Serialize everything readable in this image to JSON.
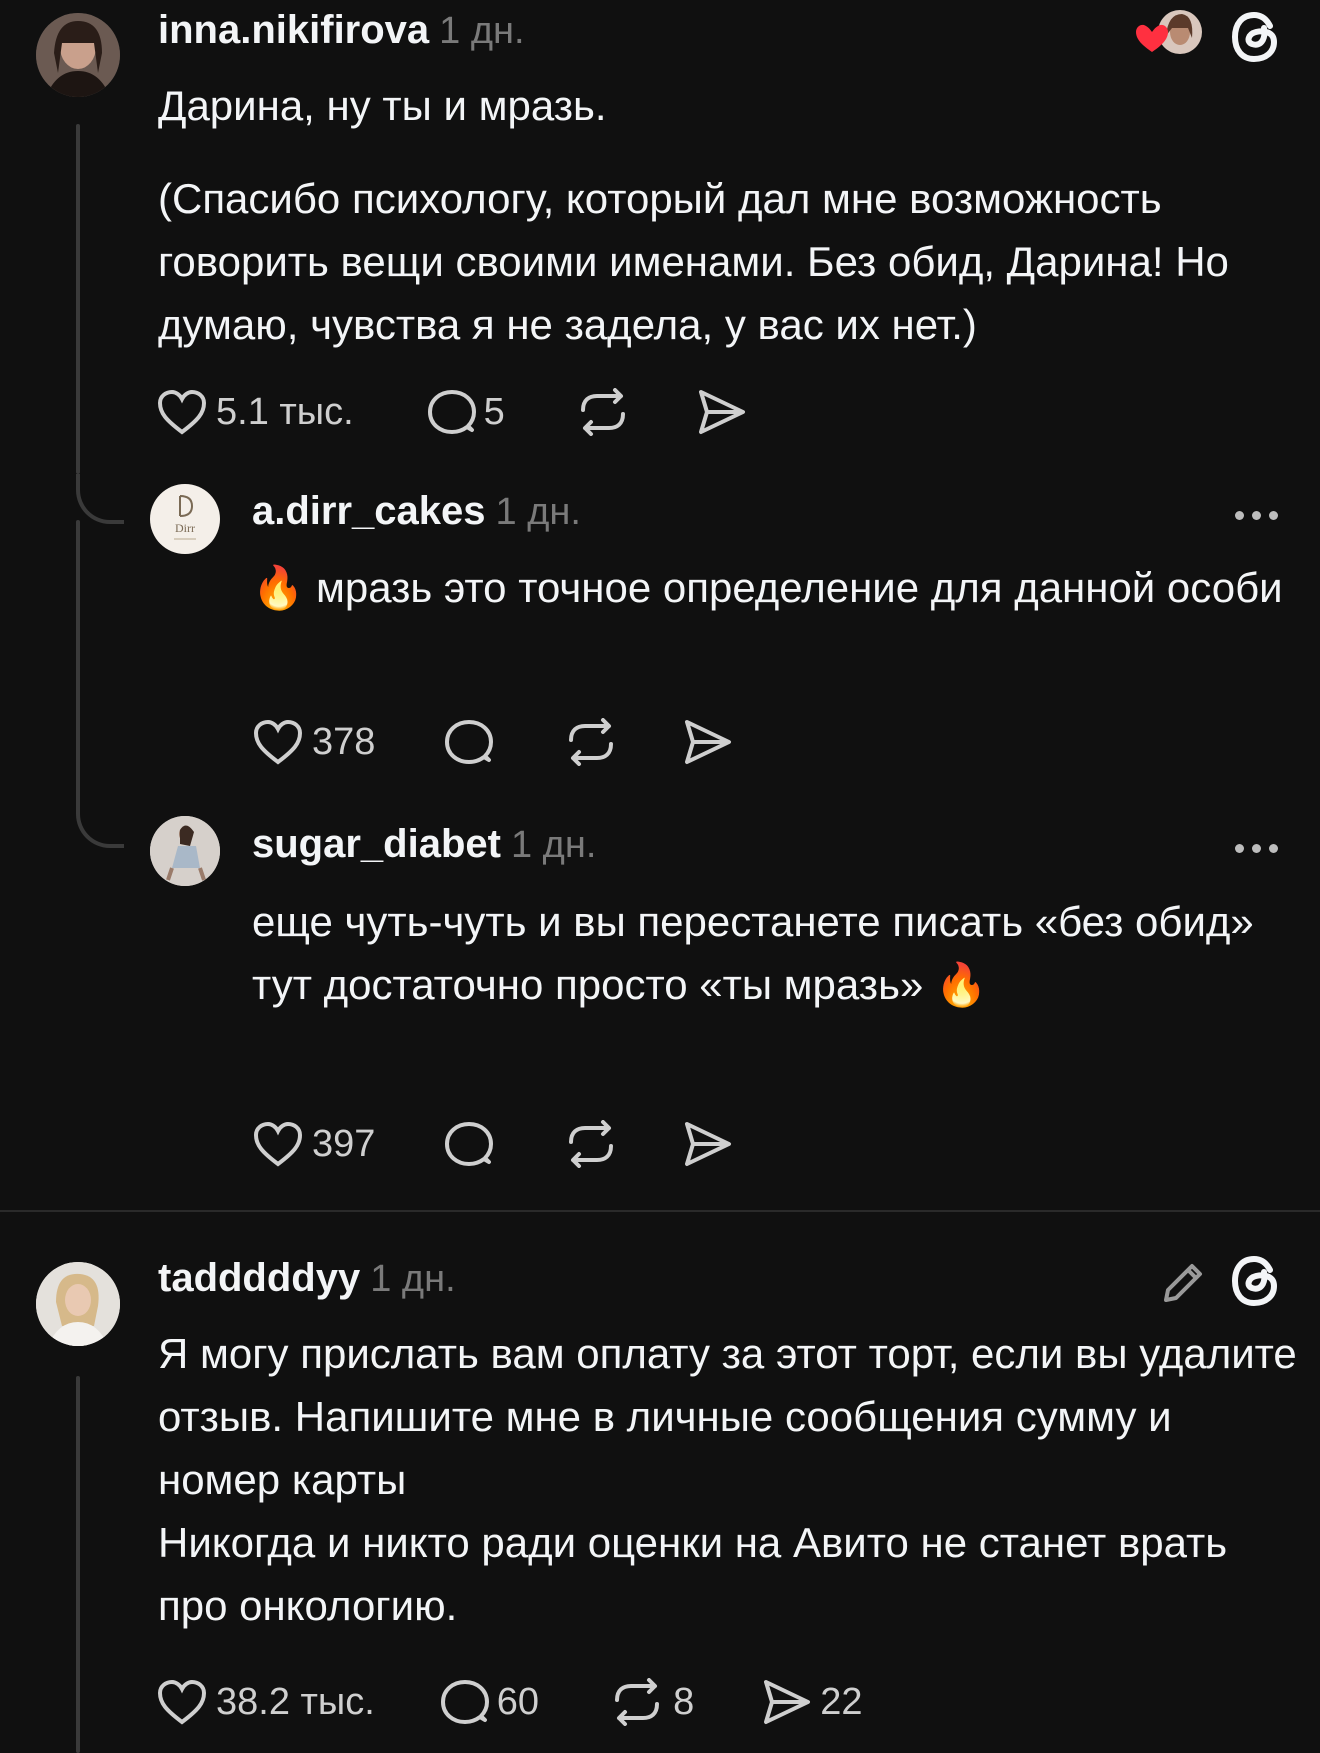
{
  "posts": [
    {
      "username": "inna.nikifirova",
      "time": "1 дн.",
      "text": [
        "Дарина, ну ты и мразь.",
        "(Спасибо психологу, который дал мне возможность говорить вещи своими именами. Без обид, Дарина! Но думаю, чувства я не задела, у вас их нет.)"
      ],
      "likes": "5.1 тыс.",
      "comments": "5",
      "avatar_icon": "user-avatar-icon",
      "header_icons": [
        "liked-heart-avatar-icon",
        "threads-logo-icon"
      ]
    },
    {
      "username": "a.dirr_cakes",
      "time": "1 дн.",
      "avatar_text": "Dirr",
      "text": [
        "🔥 мразь это точное определение для данной особи"
      ],
      "likes": "378"
    },
    {
      "username": "sugar_diabet",
      "time": "1 дн.",
      "text": [
        "еще чуть-чуть и вы перестанете писать «без обид»",
        "тут достаточно просто «ты мразь» 🔥"
      ],
      "likes": "397"
    },
    {
      "username": "tadddddyy",
      "time": "1 дн.",
      "text": [
        "Я могу прислать вам оплату за этот торт, если вы удалите отзыв. Напишите мне в личные сообщения сумму и номер карты",
        "Никогда и никто ради оценки на Авито не станет врать про онкологию."
      ],
      "likes": "38.2 тыс.",
      "comments": "60",
      "reposts": "8",
      "shares": "22",
      "header_icons": [
        "pencil-icon",
        "threads-logo-icon"
      ]
    }
  ],
  "colors": {
    "background": "#101010",
    "text": "#f3f5f7",
    "muted": "#7a7a7a",
    "line": "#3a3a3a",
    "heart": "#ff3040"
  }
}
